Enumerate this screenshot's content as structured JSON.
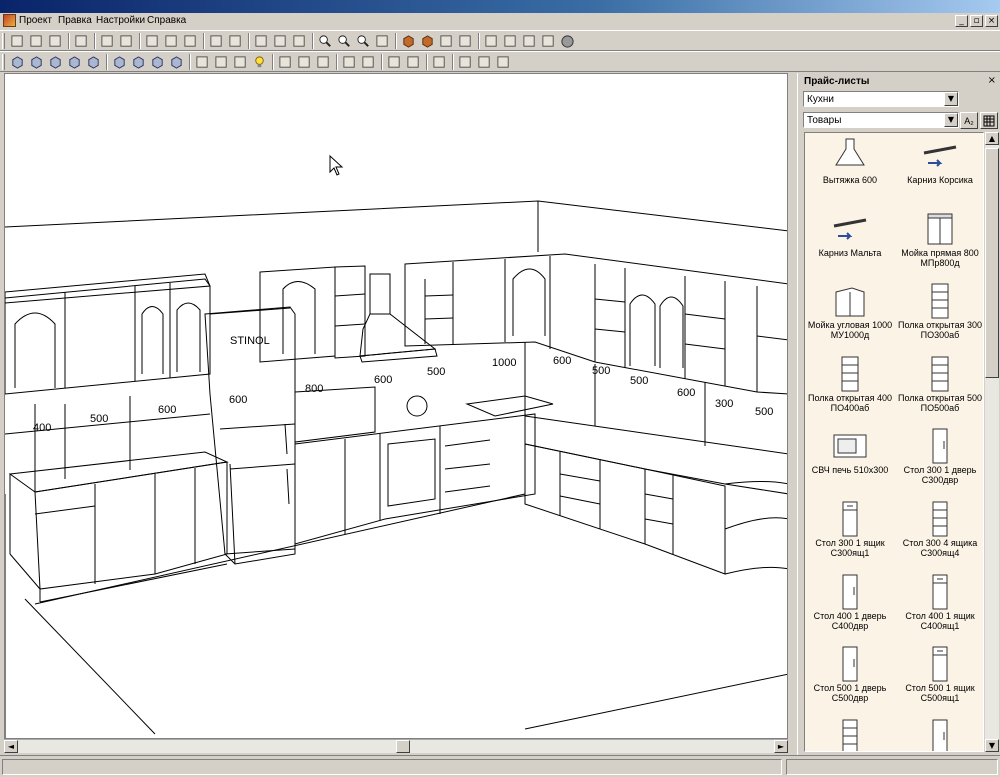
{
  "menu": {
    "items": [
      "Проект",
      "Правка",
      "Настройки",
      "Справка"
    ]
  },
  "window_controls": {
    "minimize": "_",
    "maximize": "▫",
    "close": "×"
  },
  "toolbar_row1": {
    "icons": [
      "new-file-icon",
      "open-folder-icon",
      "save-icon",
      "home-view-icon",
      "undo-icon",
      "redo-icon",
      "cut-icon",
      "copy-icon",
      "paste-icon",
      "select-arrow-icon",
      "select-frame-icon",
      "align-icon",
      "group-icon",
      "properties-icon",
      "zoom-in-icon",
      "zoom-out-icon",
      "zoom-fit-icon",
      "measure-icon",
      "box-icon",
      "texture-icon",
      "paint-icon",
      "wall-icon",
      "grid-icon",
      "edit-icon",
      "table-icon",
      "image-icon",
      "stop-icon"
    ]
  },
  "toolbar_row2": {
    "icons": [
      "view-front-icon",
      "view-back-icon",
      "view-left-icon",
      "view-right-icon",
      "view-top-icon",
      "cube-wire-icon",
      "cube-shade-icon",
      "cube-texture-icon",
      "cube-solid-icon",
      "camera-icon",
      "orbit-icon",
      "light-camera-icon",
      "lamp-icon",
      "move-view-icon",
      "pan-icon",
      "rotate-icon",
      "snap-icon",
      "snap2-icon",
      "layers-icon",
      "align-bottom-icon",
      "add-object-icon",
      "report-icon",
      "export-icon",
      "print-icon"
    ]
  },
  "scene": {
    "dimensions": [
      "400",
      "500",
      "600",
      "600",
      "800",
      "600",
      "500",
      "1000",
      "600",
      "500",
      "500",
      "600",
      "300",
      "500"
    ],
    "fridge_brand": "STINOL"
  },
  "panel": {
    "title": "Прайс-листы",
    "close": "×",
    "category_select": "Кухни",
    "goods_select": "Товары",
    "sort_button": "A₂",
    "items": [
      {
        "label": "Вытяжка 600",
        "icon": "hood-icon"
      },
      {
        "label": "Карниз Корсика",
        "icon": "cornice-icon"
      },
      {
        "label": "Карниз Мальта",
        "icon": "cornice-icon"
      },
      {
        "label": "Мойка прямая 800 МПр800д",
        "icon": "sink-cabinet-icon"
      },
      {
        "label": "Мойка угловая 1000 МУ1000д",
        "icon": "corner-sink-icon"
      },
      {
        "label": "Полка открытая 300 ПО300аб",
        "icon": "open-shelf-icon"
      },
      {
        "label": "Полка открытая 400 ПО400аб",
        "icon": "open-shelf-icon"
      },
      {
        "label": "Полка открытая 500 ПО500аб",
        "icon": "open-shelf-icon"
      },
      {
        "label": "СВЧ печь 510х300",
        "icon": "microwave-icon"
      },
      {
        "label": "Стол 300 1 дверь С300двр",
        "icon": "cabinet-door-icon"
      },
      {
        "label": "Стол 300 1 ящик С300ящ1",
        "icon": "cabinet-drawer-icon"
      },
      {
        "label": "Стол 300 4 ящика С300ящ4",
        "icon": "cabinet-drawers-icon"
      },
      {
        "label": "Стол 400 1 дверь С400двр",
        "icon": "cabinet-door-icon"
      },
      {
        "label": "Стол 400 1 ящик С400ящ1",
        "icon": "cabinet-drawer-icon"
      },
      {
        "label": "Стол 500 1 дверь С500двр",
        "icon": "cabinet-door-icon"
      },
      {
        "label": "Стол 500 1 ящик С500ящ1",
        "icon": "cabinet-drawer-icon"
      },
      {
        "label": "",
        "icon": "cabinet-drawers-icon"
      },
      {
        "label": "",
        "icon": "cabinet-door-icon"
      }
    ]
  },
  "scrollbar": {
    "left": "◄",
    "right": "►",
    "up": "▲",
    "down": "▼"
  }
}
